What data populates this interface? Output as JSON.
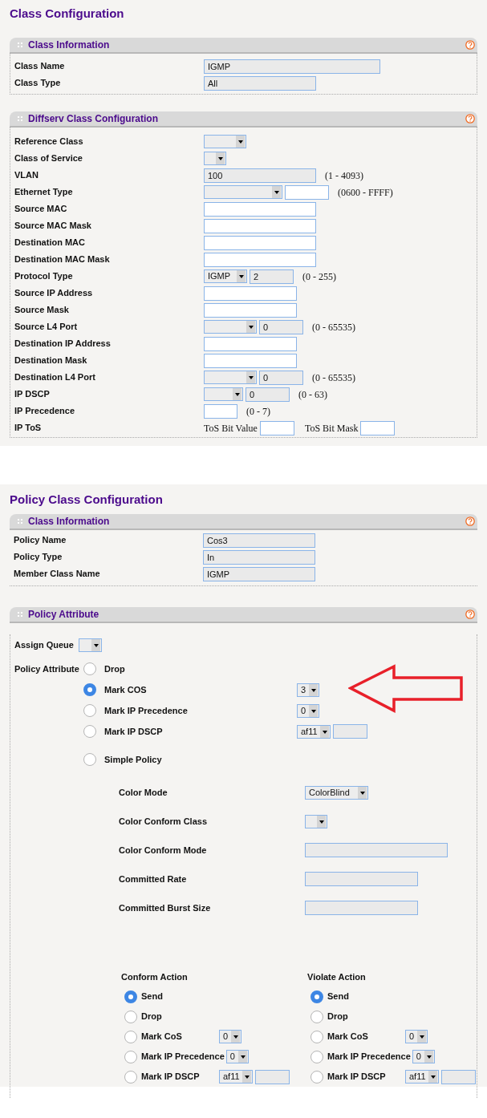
{
  "class_configuration": {
    "title": "Class Configuration",
    "sections": [
      {
        "title": "Class Information",
        "rows": [
          {
            "label": "Class Name",
            "controls": [
              {
                "kind": "text",
                "value": "IGMP",
                "disabled": true
              }
            ]
          },
          {
            "label": "Class Type",
            "controls": [
              {
                "kind": "text",
                "value": "All",
                "disabled": true
              }
            ]
          }
        ]
      },
      {
        "title": "Diffserv Class Configuration",
        "rows": [
          {
            "label": "Reference Class",
            "controls": [
              {
                "kind": "select"
              }
            ]
          },
          {
            "label": "Class of Service",
            "controls": [
              {
                "kind": "select"
              }
            ]
          },
          {
            "label": "VLAN",
            "controls": [
              {
                "kind": "text",
                "value": "100",
                "disabled": true
              },
              {
                "kind": "note",
                "text": "(1 - 4093)"
              }
            ]
          },
          {
            "label": "Ethernet Type",
            "controls": [
              {
                "kind": "select"
              },
              {
                "kind": "text",
                "disabled": false
              },
              {
                "kind": "note",
                "text": "(0600 - FFFF)"
              }
            ]
          },
          {
            "label": "Source MAC",
            "controls": [
              {
                "kind": "text",
                "disabled": false
              }
            ]
          },
          {
            "label": "Source MAC Mask",
            "controls": [
              {
                "kind": "text",
                "disabled": false
              }
            ]
          },
          {
            "label": "Destination MAC",
            "controls": [
              {
                "kind": "text",
                "disabled": false
              }
            ]
          },
          {
            "label": "Destination MAC Mask",
            "controls": [
              {
                "kind": "text",
                "disabled": false
              }
            ]
          },
          {
            "label": "Protocol Type",
            "controls": [
              {
                "kind": "select",
                "value": "IGMP"
              },
              {
                "kind": "text",
                "value": "2",
                "disabled": true
              },
              {
                "kind": "note",
                "text": "(0 - 255)"
              }
            ]
          },
          {
            "label": "Source IP Address",
            "controls": [
              {
                "kind": "text",
                "disabled": false
              }
            ]
          },
          {
            "label": "Source Mask",
            "controls": [
              {
                "kind": "text",
                "disabled": false
              }
            ]
          },
          {
            "label": "Source L4 Port",
            "controls": [
              {
                "kind": "select"
              },
              {
                "kind": "text",
                "value": "0",
                "disabled": true
              },
              {
                "kind": "note",
                "text": "(0 - 65535)"
              }
            ]
          },
          {
            "label": "Destination IP Address",
            "controls": [
              {
                "kind": "text",
                "disabled": false
              }
            ]
          },
          {
            "label": "Destination Mask",
            "controls": [
              {
                "kind": "text",
                "disabled": false
              }
            ]
          },
          {
            "label": "Destination L4 Port",
            "controls": [
              {
                "kind": "select"
              },
              {
                "kind": "text",
                "value": "0",
                "disabled": true
              },
              {
                "kind": "note",
                "text": "(0 - 65535)"
              }
            ]
          },
          {
            "label": "IP DSCP",
            "controls": [
              {
                "kind": "select"
              },
              {
                "kind": "text",
                "value": "0",
                "disabled": true
              },
              {
                "kind": "note",
                "text": "(0 - 63)"
              }
            ]
          },
          {
            "label": "IP Precedence",
            "controls": [
              {
                "kind": "text",
                "disabled": false
              },
              {
                "kind": "note",
                "text": "(0 - 7)"
              }
            ]
          },
          {
            "label": "IP ToS",
            "controls": [
              {
                "kind": "caption",
                "text": "ToS Bit Value"
              },
              {
                "kind": "text",
                "disabled": false
              },
              {
                "kind": "caption",
                "text": "ToS Bit Mask"
              },
              {
                "kind": "text",
                "disabled": false
              }
            ]
          }
        ]
      }
    ]
  },
  "policy_class_configuration": {
    "title": "Policy Class Configuration",
    "class_information": {
      "title": "Class Information",
      "rows": [
        {
          "label": "Policy Name",
          "controls": [
            {
              "kind": "text",
              "value": "Cos3",
              "disabled": true
            }
          ]
        },
        {
          "label": "Policy Type",
          "controls": [
            {
              "kind": "text",
              "value": "In",
              "disabled": true
            }
          ]
        },
        {
          "label": "Member Class Name",
          "controls": [
            {
              "kind": "text",
              "value": "IGMP",
              "disabled": true
            }
          ]
        }
      ]
    },
    "policy_attribute": {
      "title": "Policy Attribute",
      "assign_queue": {
        "label": "Assign Queue",
        "control": {
          "kind": "select"
        }
      },
      "label": "Policy Attribute",
      "options": [
        {
          "label": "Drop",
          "selected": false
        },
        {
          "label": "Mark COS",
          "selected": true,
          "controls": [
            {
              "kind": "select",
              "value": "3"
            }
          ]
        },
        {
          "label": "Mark IP Precedence",
          "selected": false,
          "controls": [
            {
              "kind": "select",
              "value": "0"
            }
          ]
        },
        {
          "label": "Mark IP DSCP",
          "selected": false,
          "controls": [
            {
              "kind": "select",
              "value": "af11"
            },
            {
              "kind": "text",
              "disabled": true
            }
          ]
        },
        {
          "label": "Simple Policy",
          "selected": false
        }
      ],
      "simple_policy_fields": [
        {
          "label": "Color Mode",
          "controls": [
            {
              "kind": "select",
              "value": "ColorBlind"
            }
          ]
        },
        {
          "label": "Color Conform Class",
          "controls": [
            {
              "kind": "select"
            }
          ]
        },
        {
          "label": "Color Conform Mode",
          "controls": [
            {
              "kind": "text",
              "disabled": true
            }
          ]
        },
        {
          "label": "Committed Rate",
          "controls": [
            {
              "kind": "text",
              "disabled": true
            }
          ]
        },
        {
          "label": "Committed Burst Size",
          "controls": [
            {
              "kind": "text",
              "disabled": true
            }
          ]
        }
      ],
      "actions": [
        {
          "title": "Conform Action",
          "options": [
            {
              "label": "Send",
              "selected": true
            },
            {
              "label": "Drop",
              "selected": false
            },
            {
              "label": "Mark CoS",
              "selected": false,
              "controls": [
                {
                  "kind": "select",
                  "value": "0"
                }
              ]
            },
            {
              "label": "Mark IP Precedence",
              "selected": false,
              "controls": [
                {
                  "kind": "select",
                  "value": "0"
                }
              ]
            },
            {
              "label": "Mark IP DSCP",
              "selected": false,
              "controls": [
                {
                  "kind": "select",
                  "value": "af11"
                },
                {
                  "kind": "text",
                  "disabled": true
                }
              ]
            }
          ]
        },
        {
          "title": "Violate Action",
          "options": [
            {
              "label": "Send",
              "selected": true
            },
            {
              "label": "Drop",
              "selected": false
            },
            {
              "label": "Mark CoS",
              "selected": false,
              "controls": [
                {
                  "kind": "select",
                  "value": "0"
                }
              ]
            },
            {
              "label": "Mark IP Precedence",
              "selected": false,
              "controls": [
                {
                  "kind": "select",
                  "value": "0"
                }
              ]
            },
            {
              "label": "Mark IP DSCP",
              "selected": false,
              "controls": [
                {
                  "kind": "select",
                  "value": "af11"
                },
                {
                  "kind": "text",
                  "disabled": true
                }
              ]
            }
          ]
        }
      ]
    }
  }
}
